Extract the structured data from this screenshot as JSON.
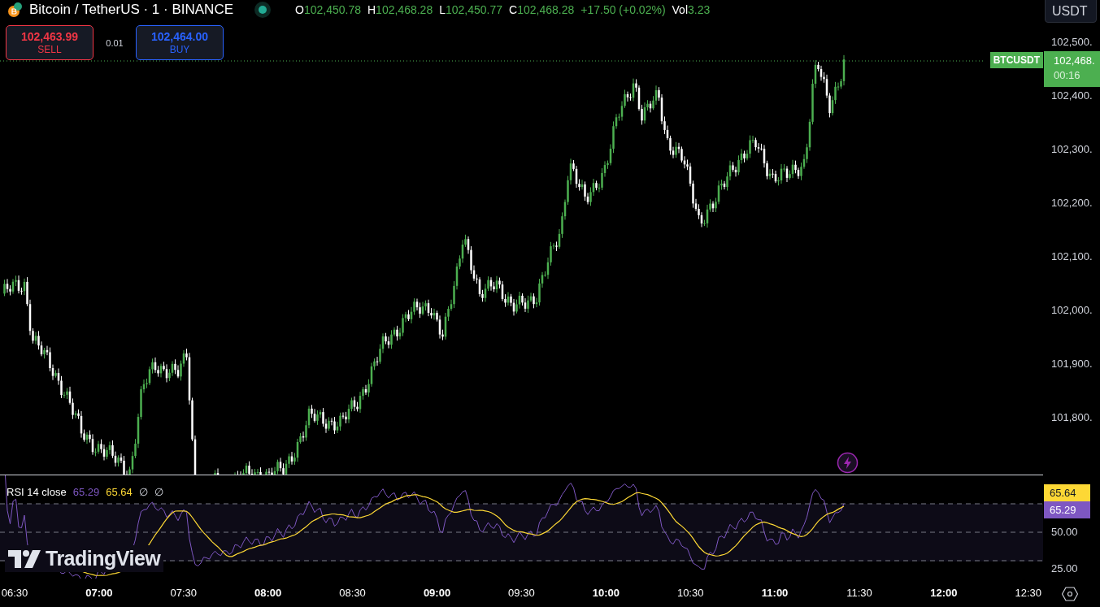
{
  "header": {
    "symbol": "Bitcoin / TetherUS · 1 · BINANCE",
    "ohlc": [
      {
        "key": "O",
        "value": "102,450.78"
      },
      {
        "key": "H",
        "value": "102,468.28"
      },
      {
        "key": "L",
        "value": "102,450.77"
      },
      {
        "key": "C",
        "value": "102,468.28"
      }
    ],
    "change": "+17.50 (+0.02%)",
    "volume": {
      "key": "Vol",
      "value": "3.23"
    }
  },
  "trade": {
    "sell": {
      "price": "102,463.99",
      "label": "SELL"
    },
    "quantity": "0.01",
    "buy": {
      "price": "102,464.00",
      "label": "BUY"
    }
  },
  "currency": "USDT",
  "price_axis": [
    "102,500.",
    "102,400.",
    "102,300.",
    "102,200.",
    "102,100.",
    "102,000.",
    "101,900.",
    "101,800."
  ],
  "last_price": {
    "symbol": "BTCUSDT",
    "price": "102,468.",
    "countdown": "00:16"
  },
  "logo": "TradingView",
  "rsi": {
    "title": "RSI 14 close",
    "value": "65.29",
    "ma": "65.64",
    "extra": [
      "∅",
      "∅"
    ],
    "axis_ma": "65.64",
    "axis_value": "65.29",
    "axis": [
      "50.00",
      "25.00"
    ]
  },
  "time_axis": [
    {
      "label": "06:30",
      "kind": "minor"
    },
    {
      "label": "07:00",
      "kind": "major"
    },
    {
      "label": "07:30",
      "kind": "minor"
    },
    {
      "label": "08:00",
      "kind": "major"
    },
    {
      "label": "08:30",
      "kind": "minor"
    },
    {
      "label": "09:00",
      "kind": "major"
    },
    {
      "label": "09:30",
      "kind": "minor"
    },
    {
      "label": "10:00",
      "kind": "major"
    },
    {
      "label": "10:30",
      "kind": "minor"
    },
    {
      "label": "11:00",
      "kind": "major"
    },
    {
      "label": "11:30",
      "kind": "minor"
    },
    {
      "label": "12:00",
      "kind": "major"
    },
    {
      "label": "12:30",
      "kind": "minor"
    }
  ]
}
